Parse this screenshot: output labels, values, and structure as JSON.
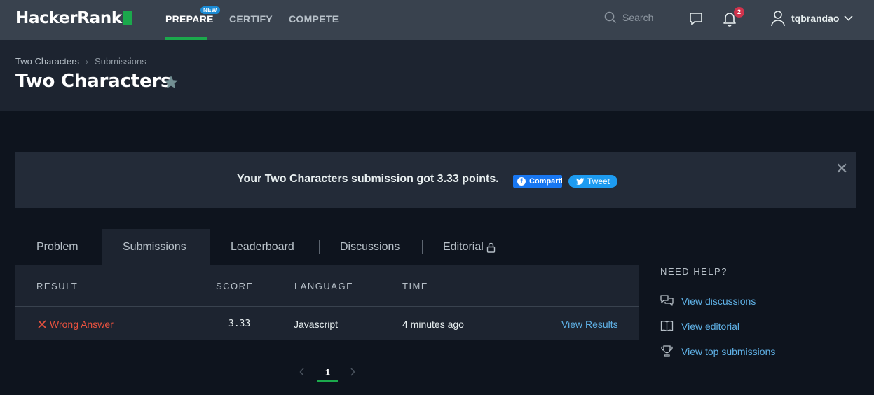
{
  "nav": {
    "logo_text": "HackerRank",
    "links": [
      {
        "label": "PREPARE"
      },
      {
        "label": "CERTIFY"
      },
      {
        "label": "COMPETE"
      }
    ],
    "new_badge": "NEW",
    "search_placeholder": "Search",
    "notification_count": "2",
    "username": "tqbrandao",
    "accent_color": "#1ba94c"
  },
  "header": {
    "breadcrumb": [
      "Two Characters",
      "Submissions"
    ],
    "title": "Two Characters"
  },
  "banner": {
    "message": "Your Two Characters submission got 3.33 points.",
    "facebook_label": "Compartilhar",
    "twitter_label": "Tweet"
  },
  "tabs": [
    {
      "label": "Problem"
    },
    {
      "label": "Submissions",
      "active": true
    },
    {
      "label": "Leaderboard"
    },
    {
      "label": "Discussions"
    },
    {
      "label": "Editorial"
    }
  ],
  "table": {
    "headers": [
      "RESULT",
      "SCORE",
      "LANGUAGE",
      "TIME"
    ],
    "rows": [
      {
        "result": "Wrong Answer",
        "score": "3.33",
        "language": "Javascript",
        "time": "4 minutes ago",
        "action": "View Results"
      }
    ]
  },
  "pagination": {
    "current_page": "1"
  },
  "help": {
    "title": "NEED HELP?",
    "items": [
      {
        "label": "View discussions",
        "icon": "discussion-icon"
      },
      {
        "label": "View editorial",
        "icon": "book-icon"
      },
      {
        "label": "View top submissions",
        "icon": "trophy-icon"
      }
    ]
  }
}
